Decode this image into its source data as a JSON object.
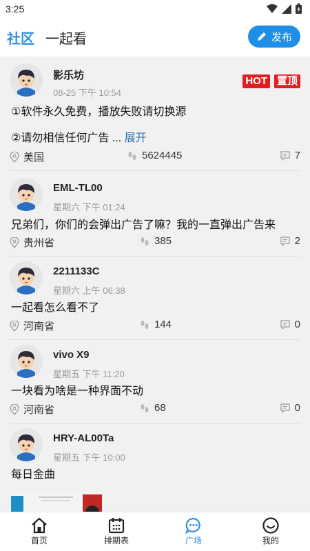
{
  "status_bar": {
    "time": "3:25"
  },
  "header": {
    "tabs": [
      {
        "label": "社区"
      },
      {
        "label": "一起看"
      }
    ],
    "publish_label": "发布",
    "accent": "#1f8ee6"
  },
  "posts": [
    {
      "user": "影乐坊",
      "time": "08-25 下午 10:54",
      "badges": [
        "HOT",
        "置顶"
      ],
      "lines": [
        "①软件永久免费，播放失败请切换源",
        "②请勿相信任何广告 ..."
      ],
      "expand": "展开",
      "location": "美国",
      "views": "5624445",
      "comments": "7"
    },
    {
      "user": "EML-TL00",
      "time": "星期六 下午 01:24",
      "lines": [
        "兄弟们，你们的会弹出广告了嘛？我的一直弹出广告来"
      ],
      "location": "贵州省",
      "views": "385",
      "comments": "2"
    },
    {
      "user": "2211133C",
      "time": "星期六 上午 06:38",
      "lines": [
        "一起看怎么看不了"
      ],
      "location": "河南省",
      "views": "144",
      "comments": "0"
    },
    {
      "user": "vivo X9",
      "time": "星期五 下午 11:20",
      "lines": [
        "一块看为啥是一种界面不动"
      ],
      "location": "河南省",
      "views": "68",
      "comments": "0"
    },
    {
      "user": "HRY-AL00Ta",
      "time": "星期五 下午 10:00",
      "lines": [
        "每日金曲"
      ]
    }
  ],
  "bottom_nav": [
    {
      "label": "首页",
      "icon": "home-icon"
    },
    {
      "label": "排期表",
      "icon": "calendar-icon"
    },
    {
      "label": "广场",
      "icon": "chat-icon"
    },
    {
      "label": "我的",
      "icon": "smile-icon"
    }
  ],
  "colors": {
    "badge": "#e02020",
    "active_nav": "#2f8fe0",
    "feed_bg": "#f1f1f1"
  }
}
